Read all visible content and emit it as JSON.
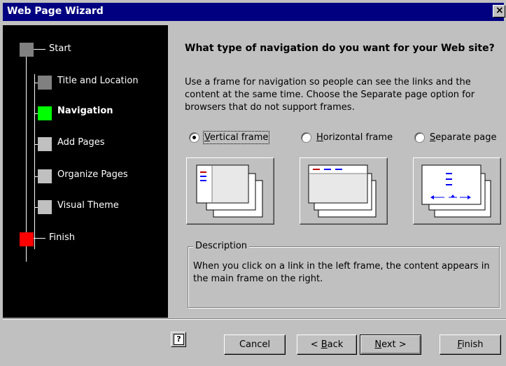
{
  "window": {
    "title": "Web Page Wizard",
    "close_glyph": "×"
  },
  "steps": [
    {
      "label": "Start",
      "color": "#808080",
      "active": false
    },
    {
      "label": "Title and Location",
      "color": "#808080",
      "active": false
    },
    {
      "label": "Navigation",
      "color": "#00ff00",
      "active": true
    },
    {
      "label": "Add Pages",
      "color": "#c0c0c0",
      "active": false
    },
    {
      "label": "Organize Pages",
      "color": "#c0c0c0",
      "active": false
    },
    {
      "label": "Visual Theme",
      "color": "#c0c0c0",
      "active": false
    },
    {
      "label": "Finish",
      "color": "#ff0000",
      "active": false
    }
  ],
  "main": {
    "heading": "What type of navigation do you want for your Web site?",
    "intro": "Use a frame for navigation so people can see the links and the content at the same time.  Choose the Separate page option for browsers that do not support frames.",
    "options": [
      {
        "label": "Vertical frame",
        "mnemonic": "V",
        "rest": "ertical frame",
        "checked": true
      },
      {
        "label": "Horizontal frame",
        "mnemonic": "H",
        "rest": "orizontal frame",
        "checked": false
      },
      {
        "label": "Separate page",
        "mnemonic": "S",
        "rest": "eparate page",
        "checked": false
      }
    ],
    "description": {
      "legend": "Description",
      "text": "When you click on a link in the left frame, the content appears in the main frame on the right."
    }
  },
  "buttons": {
    "help_glyph": "?",
    "cancel": "Cancel",
    "back": {
      "prefix": "< ",
      "mnemonic": "B",
      "rest": "ack"
    },
    "next": {
      "mnemonic": "N",
      "rest": "ext >"
    },
    "finish": {
      "mnemonic": "F",
      "rest": "inish"
    }
  },
  "colors": {
    "title_bar": "#000080",
    "link_blue": "#0000ff",
    "link_red": "#c00000"
  }
}
